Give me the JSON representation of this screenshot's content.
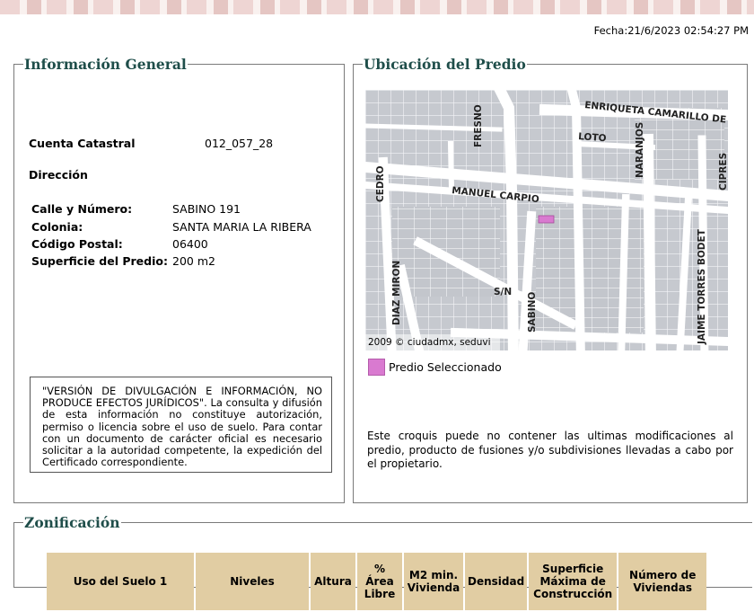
{
  "header": {
    "fecha": "Fecha:21/6/2023 02:54:27 PM"
  },
  "info_general": {
    "legend": "Información General",
    "cuenta_label": "Cuenta Catastral",
    "cuenta_value": "012_057_28",
    "direccion_label": "Dirección",
    "fields": [
      {
        "label": "Calle y Número:",
        "value": "SABINO 191"
      },
      {
        "label": "Colonia:",
        "value": "SANTA MARIA LA RIBERA"
      },
      {
        "label": "Código Postal:",
        "value": "06400"
      },
      {
        "label": "Superficie del Predio:",
        "value": "200 m2"
      }
    ],
    "disclaimer": "\"VERSIÓN DE DIVULGACIÓN E INFORMACIÓN, NO PRODUCE EFECTOS JURÍDICOS\". La consulta y difusión de esta información no constituye autorización, permiso o licencia sobre el uso de suelo. Para contar con un documento de carácter oficial es necesario solicitar a la autoridad competente, la expedición del Certificado correspondiente."
  },
  "ubicacion": {
    "legend": "Ubicación del Predio",
    "map_streets": [
      "ENRIQUETA CAMARILLO DE",
      "FRESNO",
      "LOTO",
      "NARANJOS",
      "CIPRES",
      "CEDRO",
      "MANUEL CARPIO",
      "DIAZ MIRON",
      "S/N",
      "SABINO",
      "JAIME TORRES BODET"
    ],
    "copyright": "2009 © ciudadmx, seduvi",
    "legend_label": "Predio Seleccionado",
    "selected_color": "#d97ad0",
    "note": "Este croquis puede no contener las ultimas modificaciones al predio, producto de fusiones y/o subdivisiones llevadas a cabo por el propietario."
  },
  "zonificacion": {
    "legend": "Zonificación",
    "headers": [
      "Uso del Suelo 1",
      "Niveles",
      "Altura",
      "% Área Libre",
      "M2 min. Vivienda",
      "Densidad",
      "Superficie Máxima de Construcción",
      "Número de Viviendas"
    ]
  }
}
